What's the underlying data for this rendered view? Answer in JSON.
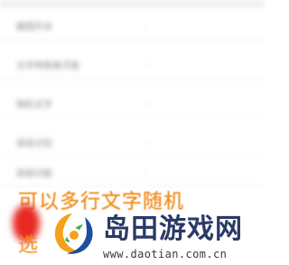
{
  "menu": {
    "items": [
      {
        "label": "截图开关"
      },
      {
        "label": "文字转换悬浮窗"
      },
      {
        "label": "随机文字"
      },
      {
        "label": "语音识别"
      },
      {
        "label": "高级功能"
      }
    ]
  },
  "overlay": {
    "line1": "可以多行文字随机",
    "line2": "选"
  },
  "watermark": {
    "title": "岛田游戏网",
    "url": "www.daotian.com.cn"
  },
  "colors": {
    "overlay_text": "#f28a16",
    "watermark_title": "#2a3a66",
    "logo_orange": "#f5a11a",
    "logo_blue": "#1c4f9c",
    "logo_green": "#38b24a"
  }
}
